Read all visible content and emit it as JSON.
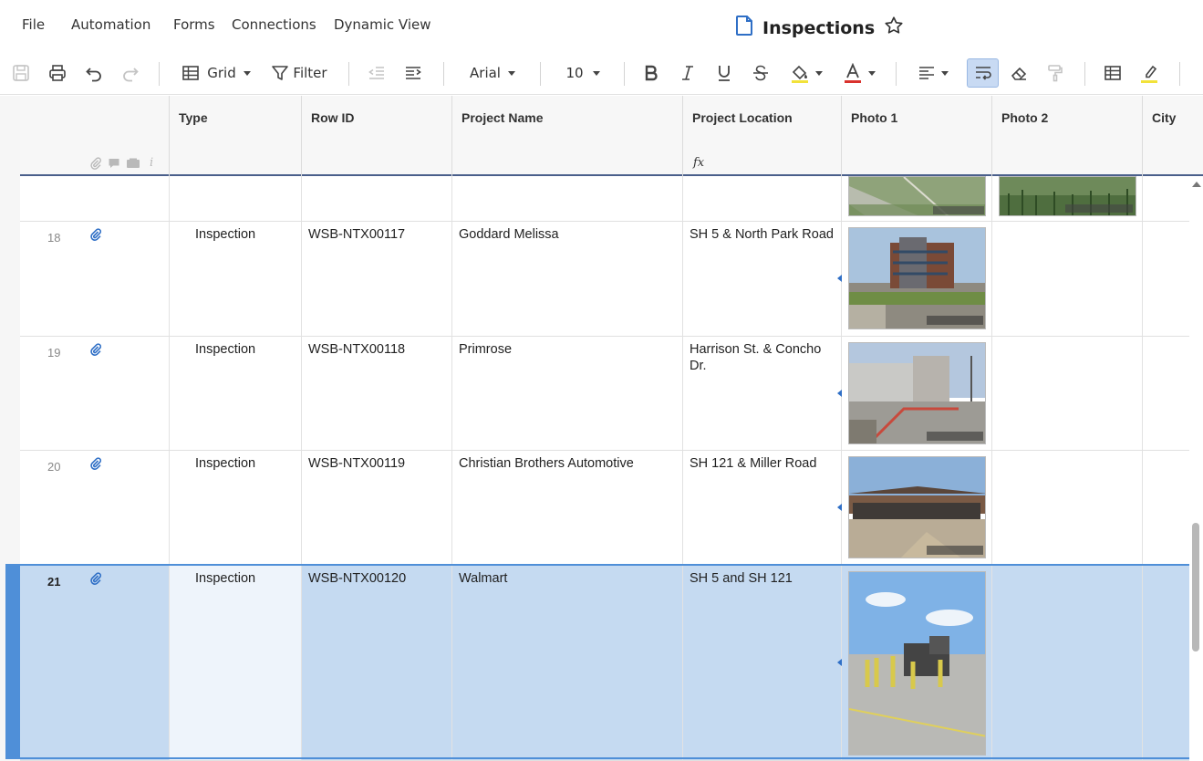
{
  "menu": [
    "File",
    "Automation",
    "Forms",
    "Connections",
    "Dynamic View"
  ],
  "sheet": {
    "title": "Inspections"
  },
  "toolbar": {
    "view_label": "Grid",
    "filter_label": "Filter",
    "font": "Arial",
    "font_size": "10"
  },
  "columns": [
    "Type",
    "Row ID",
    "Project Name",
    "Project Location",
    "Photo 1",
    "Photo 2",
    "City"
  ],
  "rows": [
    {
      "num": "18",
      "type": "Inspection",
      "row_id": "WSB-NTX00117",
      "project": "Goddard Melissa",
      "location": "SH 5 & North Park Road"
    },
    {
      "num": "19",
      "type": "Inspection",
      "row_id": "WSB-NTX00118",
      "project": "Primrose",
      "location": "Harrison St. & Concho Dr."
    },
    {
      "num": "20",
      "type": "Inspection",
      "row_id": "WSB-NTX00119",
      "project": "Christian Brothers Automotive",
      "location": "SH 121 & Miller Road"
    },
    {
      "num": "21",
      "type": "Inspection",
      "row_id": "WSB-NTX00120",
      "project": "Walmart",
      "location": "SH 5 and SH 121"
    }
  ],
  "colors": {
    "accent": "#2f6fc6",
    "selection": "#c5daf1",
    "selection_bar": "#4f8fd8"
  }
}
